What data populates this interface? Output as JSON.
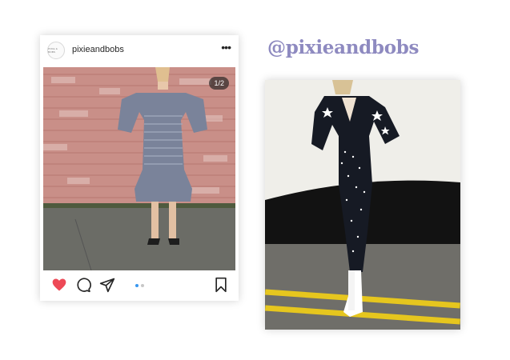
{
  "post": {
    "username": "pixieandbobs",
    "avatar_text": "PIXIE & BOBS",
    "more_icon": "more-horizontal-icon",
    "counter": "1/2",
    "actions": [
      "heart-icon",
      "comment-icon",
      "share-icon",
      "bookmark-icon"
    ],
    "carousel_dots": 2,
    "carousel_active_index": 0
  },
  "handle": "@pixieandbobs",
  "colors": {
    "handle": "#8e8ac0",
    "heart": "#ed4956",
    "dot_active": "#3897f0",
    "dot_inactive": "#c7c7c7",
    "icon": "#262626"
  }
}
